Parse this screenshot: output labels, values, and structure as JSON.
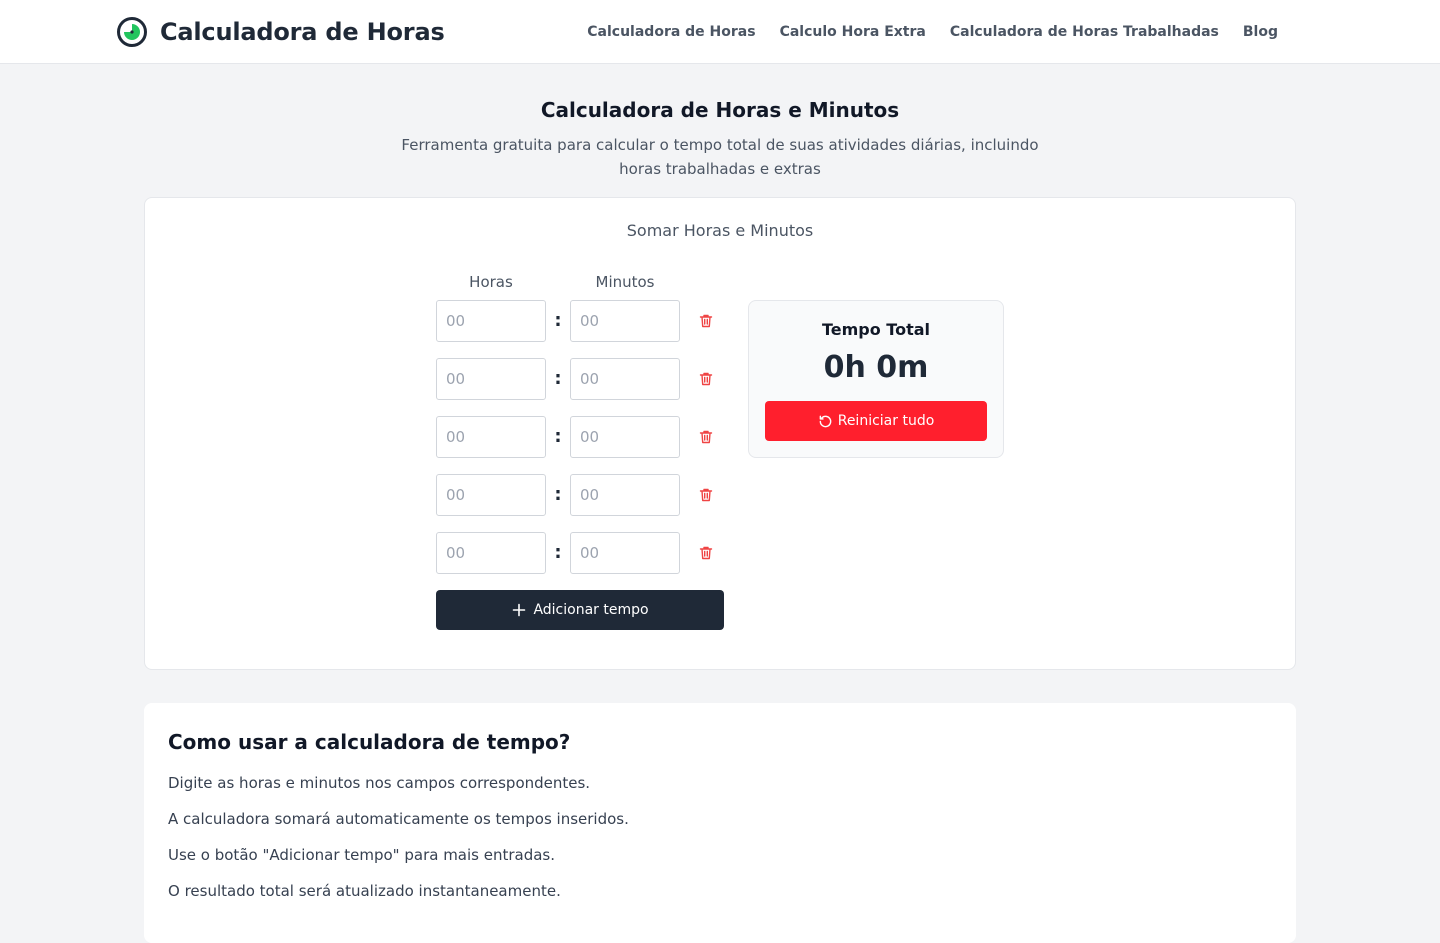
{
  "header": {
    "brand": "Calculadora de Horas",
    "nav": [
      {
        "label": "Calculadora de Horas"
      },
      {
        "label": "Calculo Hora Extra"
      },
      {
        "label": "Calculadora de Horas Trabalhadas"
      },
      {
        "label": "Blog"
      }
    ]
  },
  "hero": {
    "title": "Calculadora de Horas e Minutos",
    "subtitle": "Ferramenta gratuita para calcular o tempo total de suas atividades diárias, incluindo horas trabalhadas e extras"
  },
  "calculator": {
    "title": "Somar Horas e Minutos",
    "hours_label": "Horas",
    "minutes_label": "Minutos",
    "separator": ":",
    "rows": [
      {
        "hours_placeholder": "00",
        "minutes_placeholder": "00"
      },
      {
        "hours_placeholder": "00",
        "minutes_placeholder": "00"
      },
      {
        "hours_placeholder": "00",
        "minutes_placeholder": "00"
      },
      {
        "hours_placeholder": "00",
        "minutes_placeholder": "00"
      },
      {
        "hours_placeholder": "00",
        "minutes_placeholder": "00"
      }
    ],
    "add_label": "Adicionar tempo",
    "total_label": "Tempo Total",
    "total_value": "0h 0m",
    "reset_label": "Reiniciar tudo"
  },
  "howto": {
    "title": "Como usar a calculadora de tempo?",
    "items": [
      "Digite as horas e minutos nos campos correspondentes.",
      "A calculadora somará automaticamente os tempos inseridos.",
      "Use o botão \"Adicionar tempo\" para mais entradas.",
      "O resultado total será atualizado instantaneamente."
    ]
  },
  "colors": {
    "brand_icon_ring": "#1f2937",
    "brand_icon_fill": "#22c55e",
    "reset": "#ff1f2d",
    "add": "#1f2937",
    "trash": "#ef4444"
  },
  "icons": {
    "brand": "clock-pie-icon",
    "delete": "trash-icon",
    "add": "plus-icon",
    "reset": "rotate-ccw-icon"
  }
}
